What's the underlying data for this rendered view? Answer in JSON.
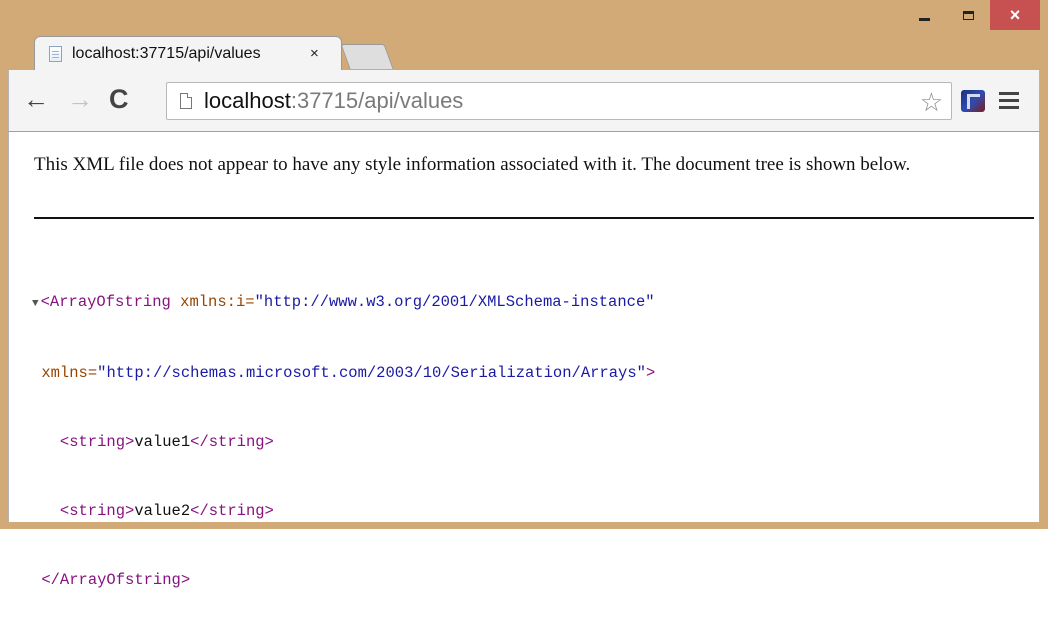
{
  "tab": {
    "title": "localhost:37715/api/values",
    "close_label": "×"
  },
  "window": {
    "minimize_label": "",
    "maximize_label": "",
    "close_label": "×"
  },
  "nav": {
    "back_icon": "←",
    "forward_icon": "→",
    "reload_icon": "C"
  },
  "omnibox": {
    "url_host": "localhost",
    "url_rest": ":37715/api/values",
    "star_icon": "☆"
  },
  "content": {
    "info_text": "This XML file does not appear to have any style information associated with it. The document tree is shown below.",
    "xml": {
      "toggle": "▼",
      "root_open": "<ArrayOfstring",
      "attr1_name": "xmlns:i",
      "attr1_eq": "=",
      "attr1_value": "\"http://www.w3.org/2001/XMLSchema-instance\"",
      "attr2_name": "xmlns",
      "attr2_eq": "=",
      "attr2_value": "\"http://schemas.microsoft.com/2003/10/Serialization/Arrays\"",
      "root_open_end": ">",
      "items": [
        {
          "open": "<string>",
          "text": "value1",
          "close": "</string>"
        },
        {
          "open": "<string>",
          "text": "value2",
          "close": "</string>"
        }
      ],
      "root_close": "</ArrayOfstring>"
    }
  },
  "colors": {
    "frame": "#d2aa78",
    "close_button": "#c75050",
    "xml_tag": "#881280",
    "xml_attr": "#994500",
    "xml_value": "#1a1aa6"
  },
  "icons": [
    "page-icon",
    "back-icon",
    "forward-icon",
    "reload-icon",
    "star-icon",
    "extension-icon",
    "menu-icon"
  ]
}
